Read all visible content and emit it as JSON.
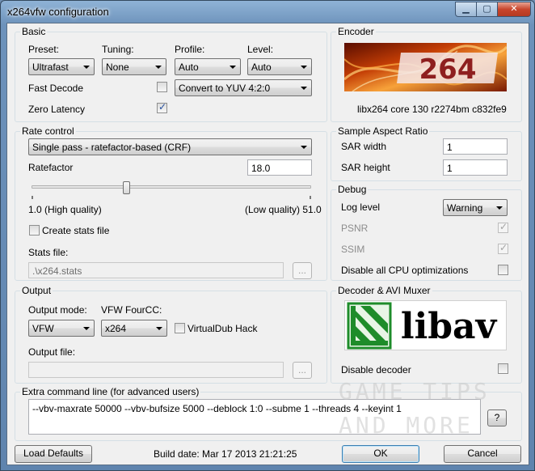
{
  "window": {
    "title": "x264vfw configuration"
  },
  "basic": {
    "group_label": "Basic",
    "preset_label": "Preset:",
    "preset_value": "Ultrafast",
    "tuning_label": "Tuning:",
    "tuning_value": "None",
    "profile_label": "Profile:",
    "profile_value": "Auto",
    "level_label": "Level:",
    "level_value": "Auto",
    "fast_decode_label": "Fast Decode",
    "fast_decode_checked": false,
    "colorspace_value": "Convert to YUV 4:2:0",
    "zero_latency_label": "Zero Latency",
    "zero_latency_checked": true
  },
  "encoder": {
    "group_label": "Encoder",
    "logo_text": "264",
    "version_text": "libx264 core 130 r2274bm c832fe9"
  },
  "rate_control": {
    "group_label": "Rate control",
    "mode_value": "Single pass - ratefactor-based (CRF)",
    "ratefactor_label": "Ratefactor",
    "ratefactor_value": "18.0",
    "slider_fraction": 0.34,
    "min_label": "1.0 (High quality)",
    "max_label": "(Low quality) 51.0",
    "create_stats_label": "Create stats file",
    "create_stats_checked": false,
    "stats_file_label": "Stats file:",
    "stats_file_value": ".\\x264.stats",
    "browse_label": "..."
  },
  "sar": {
    "group_label": "Sample Aspect Ratio",
    "width_label": "SAR width",
    "width_value": "1",
    "height_label": "SAR height",
    "height_value": "1"
  },
  "debug": {
    "group_label": "Debug",
    "log_level_label": "Log level",
    "log_level_value": "Warning",
    "psnr_label": "PSNR",
    "psnr_checked": true,
    "ssim_label": "SSIM",
    "ssim_checked": true,
    "disable_cpu_label": "Disable all CPU optimizations",
    "disable_cpu_checked": false
  },
  "output": {
    "group_label": "Output",
    "mode_label": "Output mode:",
    "mode_value": "VFW",
    "fourcc_label": "VFW FourCC:",
    "fourcc_value": "x264",
    "vdub_label": "VirtualDub Hack",
    "vdub_checked": false,
    "file_label": "Output file:",
    "file_value": "",
    "browse_label": "..."
  },
  "decoder": {
    "group_label": "Decoder & AVI Muxer",
    "logo_text": "libav",
    "disable_label": "Disable decoder",
    "disable_checked": false
  },
  "extra": {
    "group_label": "Extra command line (for advanced users)",
    "value": "--vbv-maxrate 50000 --vbv-bufsize 5000 --deblock 1:0 --subme 1 --threads 4  --keyint 1",
    "help_label": "?"
  },
  "watermark": {
    "line1": "GAME TIPS",
    "line2": "AND MORE"
  },
  "footer": {
    "load_defaults_label": "Load Defaults",
    "build_date": "Build date: Mar 17 2013 21:21:25",
    "ok_label": "OK",
    "cancel_label": "Cancel"
  },
  "colors": {
    "title_bar": "#6d92bb",
    "client_bg": "#f0f0f0",
    "libav_green": "#1e8c2a"
  }
}
